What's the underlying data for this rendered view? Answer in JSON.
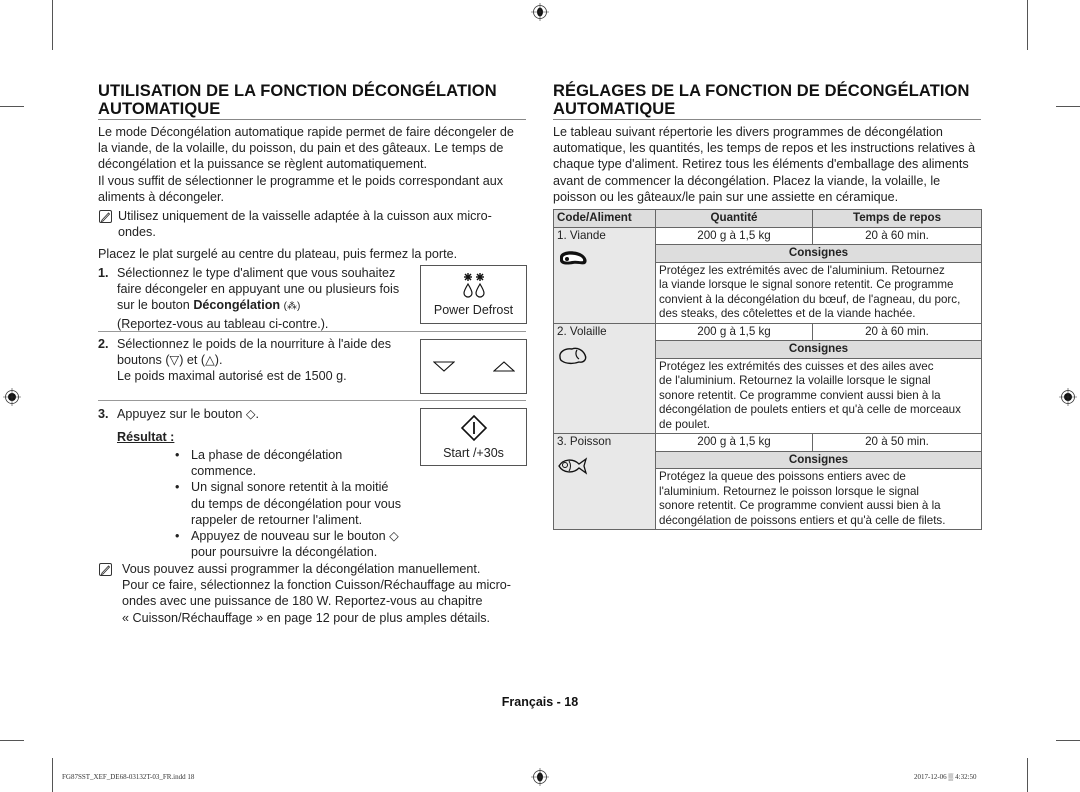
{
  "left": {
    "title_line1": "UTILISATION DE LA FONCTION DÉCONGÉLATION",
    "title_line2": "AUTOMATIQUE",
    "intro": [
      "Le mode Décongélation automatique rapide permet de faire décongeler de",
      "la viande, de la volaille, du poisson, du pain et des gâteaux. Le temps de",
      "décongélation et la puissance se règlent automatiquement.",
      "Il vous suffit de sélectionner le programme et le poids correspondant aux",
      "aliments à décongeler."
    ],
    "note1": [
      "Utilisez uniquement de la vaisselle adaptée à la cuisson aux micro-",
      "ondes."
    ],
    "place_text": "Placez le plat surgelé au centre du plateau, puis fermez la porte.",
    "step1": {
      "num": "1.",
      "line1": "Sélectionnez le type d'aliment que vous souhaitez",
      "line2": "faire décongeler en appuyant une ou plusieurs fois",
      "line3_prefix": "sur le bouton ",
      "line3_bold": "Décongélation",
      "line3_icon": "(⁂)",
      "line4": "(Reportez-vous au tableau ci-contre.).",
      "button_label": "Power Defrost",
      "button_icon": "power-defrost-icon"
    },
    "step2": {
      "num": "2.",
      "line1": "Sélectionnez le poids de la nourriture à l'aide des",
      "line2": "boutons (▽) et (△).",
      "line3": "Le poids maximal autorisé est de 1500 g.",
      "button_icons": [
        "down-arrow-icon",
        "up-arrow-icon"
      ]
    },
    "step3": {
      "num": "3.",
      "line1": "Appuyez sur le bouton ◇.",
      "result_label": "Résultat :",
      "bullets": [
        [
          "La phase de décongélation",
          "commence."
        ],
        [
          "Un signal sonore retentit à la moitié",
          "du temps de décongélation pour vous",
          "rappeler de retourner l'aliment."
        ],
        [
          "Appuyez de nouveau sur le bouton ◇",
          "pour poursuivre la décongélation."
        ]
      ],
      "button_label": "Start /+30s",
      "button_icon": "start-icon"
    },
    "note2": [
      "Vous pouvez aussi programmer la décongélation manuellement.",
      "Pour ce faire, sélectionnez la fonction Cuisson/Réchauffage au micro-",
      "ondes avec une puissance de 180 W. Reportez-vous au chapitre",
      "« Cuisson/Réchauffage » en page 12 pour de plus amples détails."
    ]
  },
  "right": {
    "title_line1": "RÉGLAGES DE LA FONCTION DE DÉCONGÉLATION",
    "title_line2": "AUTOMATIQUE",
    "intro": [
      "Le tableau suivant répertorie les divers programmes de décongélation",
      "automatique, les quantités, les temps de repos et les instructions relatives à",
      "chaque type d'aliment. Retirez tous les éléments d'emballage des aliments",
      "avant de commencer la décongélation. Placez la viande, la volaille, le",
      "poisson ou les gâteaux/le pain sur une assiette en céramique."
    ],
    "table": {
      "headers": [
        "Code/Aliment",
        "Quantité",
        "Temps de repos"
      ],
      "consignes_label": "Consignes",
      "rows": [
        {
          "code": "1. Viande",
          "icon": "meat-icon",
          "quantity": "200 g à 1,5 kg",
          "rest": "20 à 60 min.",
          "instructions": [
            "Protégez les extrémités avec de l'aluminium. Retournez",
            "la viande lorsque le signal sonore retentit. Ce programme",
            "convient à la décongélation du bœuf, de l'agneau, du porc,",
            "des steaks, des côtelettes et de la viande hachée."
          ]
        },
        {
          "code": "2. Volaille",
          "icon": "poultry-icon",
          "quantity": "200 g à 1,5 kg",
          "rest": "20 à 60 min.",
          "instructions": [
            "Protégez les extrémités des cuisses et des ailes avec",
            "de l'aluminium. Retournez la volaille lorsque le signal",
            "sonore retentit. Ce programme convient aussi bien à la",
            "décongélation de poulets entiers et qu'à celle de morceaux",
            "de poulet."
          ]
        },
        {
          "code": "3. Poisson",
          "icon": "fish-icon",
          "quantity": "200 g à 1,5 kg",
          "rest": "20 à 50 min.",
          "instructions": [
            "Protégez la queue des poissons entiers avec de",
            "l'aluminium. Retournez le poisson lorsque le signal",
            "sonore retentit. Ce programme convient aussi bien à la",
            "décongélation de poissons entiers et qu'à celle de filets."
          ]
        }
      ]
    }
  },
  "page_number": "Français - 18",
  "footer": {
    "file": "FG87SST_XEF_DE68-03132T-03_FR.indd   18",
    "timestamp": "2017-12-06   ▒ 4:32:50"
  }
}
